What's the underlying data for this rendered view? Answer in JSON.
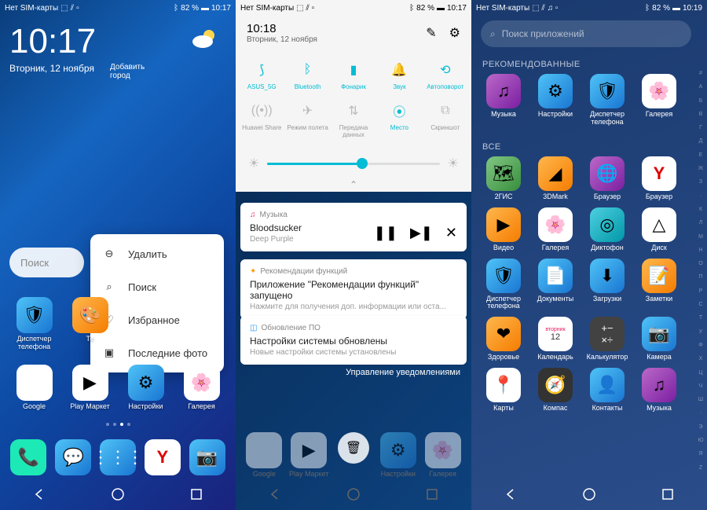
{
  "status": {
    "sim": "Нет SIM-карты",
    "battery": "82 %",
    "time1": "10:17",
    "time2": "10:17",
    "time3": "10:19"
  },
  "phone1": {
    "time": "10:17",
    "add_city": "Добавить город",
    "date": "Вторник, 12 ноября",
    "search": "Поиск",
    "menu": {
      "delete": "Удалить",
      "search": "Поиск",
      "favorite": "Избранное",
      "recent": "Последние фото"
    },
    "apps_row1": [
      "Диспетчер телефона",
      "Те"
    ],
    "apps_row2": [
      "Google",
      "Play Маркет",
      "Настройки",
      "Галерея"
    ],
    "dock": [
      "phone",
      "messages",
      "drawer",
      "yandex",
      "camera"
    ]
  },
  "phone2": {
    "time": "10:18",
    "date": "Вторник, 12 ноября",
    "qs": [
      {
        "label": "ASUS_5G",
        "active": true
      },
      {
        "label": "Bluetooth",
        "active": true
      },
      {
        "label": "Фонарик",
        "active": true
      },
      {
        "label": "Звук",
        "active": true
      },
      {
        "label": "Автоповорот",
        "active": true
      },
      {
        "label": "Huawei Share",
        "active": false
      },
      {
        "label": "Режим полета",
        "active": false
      },
      {
        "label": "Передача данных",
        "active": false
      },
      {
        "label": "Место",
        "active": true
      },
      {
        "label": "Скриншот",
        "active": false
      }
    ],
    "music": {
      "app": "Музыка",
      "title": "Bloodsucker",
      "artist": "Deep Purple"
    },
    "notif1": {
      "app": "Рекомендации функций",
      "title": "Приложение \"Рекомендации функций\" запущено",
      "sub": "Нажмите для получения доп. информации или оста..."
    },
    "notif2": {
      "app": "Обновление ПО",
      "title": "Настройки системы обновлены",
      "sub": "Новые настройки системы установлены"
    },
    "manage": "Управление уведомлениями",
    "apps": [
      "Google",
      "Play Маркет",
      "Настройки",
      "Галерея"
    ]
  },
  "phone3": {
    "search": "Поиск приложений",
    "section1": "РЕКОМЕНДОВАННЫЕ",
    "section2": "ВСЕ",
    "recommended": [
      "Музыка",
      "Настройки",
      "Диспетчер телефона",
      "Галерея"
    ],
    "all": [
      "2ГИС",
      "3DMark",
      "Браузер",
      "Браузер",
      "Видео",
      "Галерея",
      "Диктофон",
      "Диск",
      "Диспетчер телефона",
      "Документы",
      "Загрузки",
      "Заметки",
      "Здоровье",
      "Календарь",
      "Калькулятор",
      "Камера",
      "Карты",
      "Компас",
      "Контакты",
      "Музыка"
    ],
    "az": [
      "#",
      "А",
      "Б",
      "В",
      "Г",
      "Д",
      "Е",
      "Ж",
      "З",
      "·",
      "К",
      "Л",
      "М",
      "Н",
      "О",
      "П",
      "Р",
      "С",
      "Т",
      "У",
      "Ф",
      "Х",
      "Ц",
      "Ч",
      "Ш",
      "·",
      "Э",
      "Ю",
      "Я",
      "Z"
    ]
  }
}
